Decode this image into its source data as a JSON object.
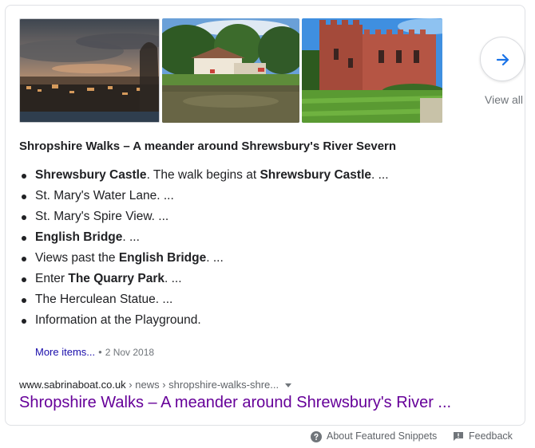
{
  "carousel": {
    "images": [
      {
        "alt": "Shrewsbury skyline at dusk",
        "icon": "landscape-photo"
      },
      {
        "alt": "Riverside pub by the water",
        "icon": "landscape-photo"
      },
      {
        "alt": "Shrewsbury Castle",
        "icon": "landscape-photo"
      }
    ],
    "next_icon": "arrow-right-icon",
    "view_all_label": "View all"
  },
  "snippet": {
    "title": "Shropshire Walks – A meander around Shrewsbury's River Severn",
    "items": [
      {
        "bold": "Shrewsbury Castle",
        "text1": ". The walk begins at ",
        "bold2": "Shrewsbury Castle",
        "text2": ". ..."
      },
      {
        "text1": "St. Mary's Water Lane. ..."
      },
      {
        "text1": "St. Mary's Spire View. ..."
      },
      {
        "bold": "English Bridge",
        "text1": ". ..."
      },
      {
        "pre": "Views past the ",
        "bold": "English Bridge",
        "text1": ". ..."
      },
      {
        "pre": "Enter ",
        "bold": "The Quarry Park",
        "text1": ". ..."
      },
      {
        "text1": "The Herculean Statue. ..."
      },
      {
        "text1": "Information at the Playground."
      }
    ],
    "more_items_label": "More items...",
    "separator": "•",
    "date": "2 Nov 2018"
  },
  "result": {
    "domain": "www.sabrinaboat.co.uk",
    "path": " › news › shropshire-walks-shre...",
    "title": "Shropshire Walks – A meander around Shrewsbury's River ..."
  },
  "footer": {
    "about_label": "About Featured Snippets",
    "about_icon": "help-circle-icon",
    "feedback_label": "Feedback",
    "feedback_icon": "feedback-icon"
  },
  "colors": {
    "link_visited": "#660099",
    "link": "#1a0dab",
    "accent": "#1a73e8",
    "muted": "#70757a"
  }
}
